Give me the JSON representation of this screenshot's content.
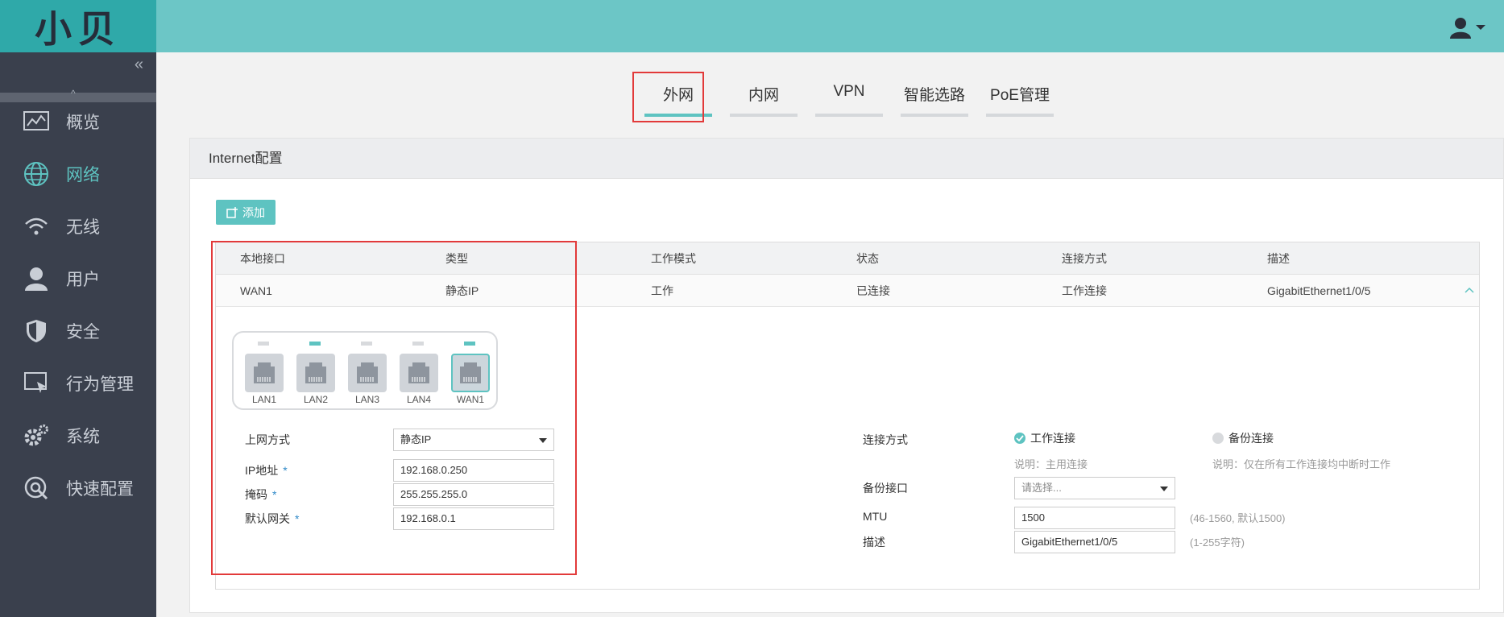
{
  "logo": "小贝",
  "sidebar": {
    "collapse": "«",
    "scroll_up": "^",
    "items": [
      {
        "label": "概览",
        "icon": "chart-icon"
      },
      {
        "label": "网络",
        "icon": "globe-icon"
      },
      {
        "label": "无线",
        "icon": "wifi-icon"
      },
      {
        "label": "用户",
        "icon": "user-icon"
      },
      {
        "label": "安全",
        "icon": "shield-icon"
      },
      {
        "label": "行为管理",
        "icon": "monitor-icon"
      },
      {
        "label": "系统",
        "icon": "gear-icon"
      },
      {
        "label": "快速配置",
        "icon": "quick-config-icon"
      }
    ]
  },
  "tabs": [
    {
      "label": "外网"
    },
    {
      "label": "内网"
    },
    {
      "label": "VPN"
    },
    {
      "label": "智能选路"
    },
    {
      "label": "PoE管理"
    }
  ],
  "panel": {
    "title": "Internet配置",
    "add_label": "添加"
  },
  "table": {
    "headers": [
      "本地接口",
      "类型",
      "工作模式",
      "状态",
      "连接方式",
      "描述"
    ],
    "row": [
      "WAN1",
      "静态IP",
      "工作",
      "已连接",
      "工作连接",
      "GigabitEthernet1/0/5"
    ]
  },
  "ports": [
    {
      "name": "LAN1",
      "led": "off"
    },
    {
      "name": "LAN2",
      "led": "on"
    },
    {
      "name": "LAN3",
      "led": "off"
    },
    {
      "name": "LAN4",
      "led": "off"
    },
    {
      "name": "WAN1",
      "led": "on",
      "selected": true
    }
  ],
  "form_left": {
    "access_label": "上网方式",
    "access_value": "静态IP",
    "ip_label": "IP地址",
    "ip_value": "192.168.0.250",
    "mask_label": "掩码",
    "mask_value": "255.255.255.0",
    "gateway_label": "默认网关",
    "gateway_value": "192.168.0.1",
    "required": "*"
  },
  "form_right": {
    "conn_label": "连接方式",
    "opt_work": "工作连接",
    "opt_backup": "备份连接",
    "note_work": "说明：主用连接",
    "note_backup": "说明：仅在所有工作连接均中断时工作",
    "backup_if_label": "备份接口",
    "backup_if_placeholder": "请选择...",
    "mtu_label": "MTU",
    "mtu_value": "1500",
    "mtu_hint": "(46-1560, 默认1500)",
    "desc_label": "描述",
    "desc_value": "GigabitEthernet1/0/5",
    "desc_hint": "(1-255字符)"
  },
  "colors": {
    "accent": "#5ec3c1",
    "topbar": "#6cc6c6",
    "sidebar": "#3a404d",
    "highlight": "#e23a3a"
  }
}
